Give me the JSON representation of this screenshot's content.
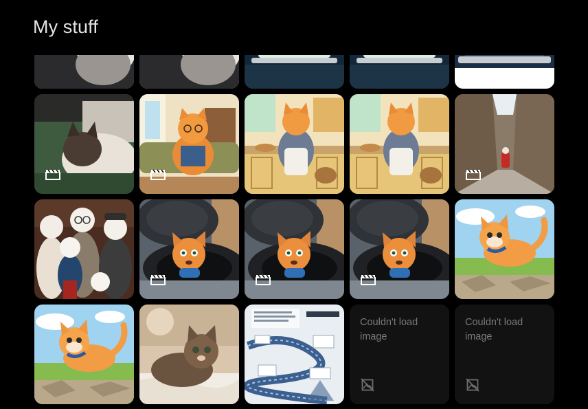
{
  "header": {
    "title": "My stuff"
  },
  "colors": {
    "background": "#000000",
    "title": "#e3e3e3",
    "broken_tile": "#121212",
    "broken_text": "#7a7a7a"
  },
  "tiles": [
    {
      "kind": "person-cat",
      "video": false
    },
    {
      "kind": "person-cat",
      "video": false
    },
    {
      "kind": "laptop",
      "video": false
    },
    {
      "kind": "laptop",
      "video": false
    },
    {
      "kind": "laptop-white",
      "video": false
    },
    {
      "kind": "siamese-cat",
      "video": true
    },
    {
      "kind": "cat-sofa",
      "video": true
    },
    {
      "kind": "cat-kitchen",
      "video": false
    },
    {
      "kind": "cat-kitchen",
      "video": false
    },
    {
      "kind": "alley",
      "video": true
    },
    {
      "kind": "cat-family",
      "video": false
    },
    {
      "kind": "cat-manhole",
      "video": true
    },
    {
      "kind": "cat-manhole",
      "video": true
    },
    {
      "kind": "cat-manhole",
      "video": true
    },
    {
      "kind": "cat-running",
      "video": false
    },
    {
      "kind": "cat-running",
      "video": false
    },
    {
      "kind": "kitten",
      "video": false
    },
    {
      "kind": "infographic",
      "video": false
    },
    {
      "kind": "broken",
      "video": false,
      "message": "Couldn't load image"
    },
    {
      "kind": "broken",
      "video": false,
      "message": "Couldn't load image"
    }
  ]
}
